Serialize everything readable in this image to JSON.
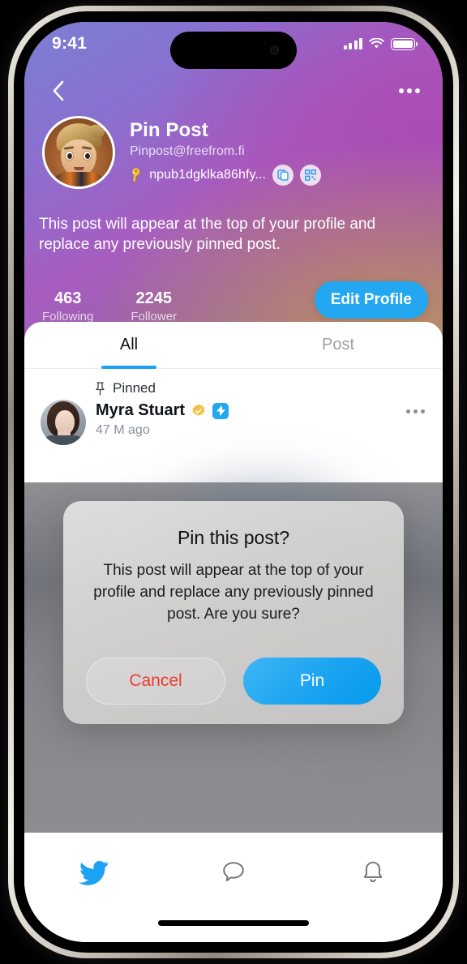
{
  "status_bar": {
    "time": "9:41",
    "signal_icon": "cellular-bars-icon",
    "wifi_icon": "wifi-icon",
    "battery_icon": "battery-icon"
  },
  "nav": {
    "back_icon": "chevron-left-icon",
    "more_icon": "more-horizontal-icon"
  },
  "profile": {
    "avatar_icon": "user-avatar",
    "display_name": "Pin Post",
    "handle": "Pinpost@freefrom.fi",
    "key_icon": "key-icon",
    "npub": "npub1dgklka86hfy...",
    "copy_icon": "copy-icon",
    "qr_icon": "qr-code-icon",
    "bio": "This post will appear at the top of your profile and replace any previously pinned post.",
    "stats": [
      {
        "value": "463",
        "label": "Following"
      },
      {
        "value": "2245",
        "label": "Follower"
      }
    ],
    "edit_button": "Edit Profile"
  },
  "tabs": [
    {
      "label": "All",
      "active": true
    },
    {
      "label": "Post",
      "active": false
    }
  ],
  "pinned_post": {
    "pin_icon": "pin-icon",
    "pinned_label": "Pinned",
    "author_avatar": "author-avatar",
    "author": "Myra Stuart",
    "verified_icon": "verified-badge-icon",
    "zap_icon": "lightning-badge-icon",
    "time": "47 M ago",
    "more_icon": "more-horizontal-icon"
  },
  "modal": {
    "title": "Pin this post?",
    "body": "This post will appear at the top of your profile and replace any previously pinned post. Are you sure?",
    "cancel_label": "Cancel",
    "confirm_label": "Pin"
  },
  "bottom_nav": [
    {
      "icon": "bird-home-icon",
      "active": true
    },
    {
      "icon": "chat-bubble-icon",
      "active": false
    },
    {
      "icon": "bell-icon",
      "active": false
    }
  ],
  "colors": {
    "accent_blue": "#1DA1F2",
    "cancel_red": "#EE3B2F",
    "verified_gold": "#F5C242"
  }
}
